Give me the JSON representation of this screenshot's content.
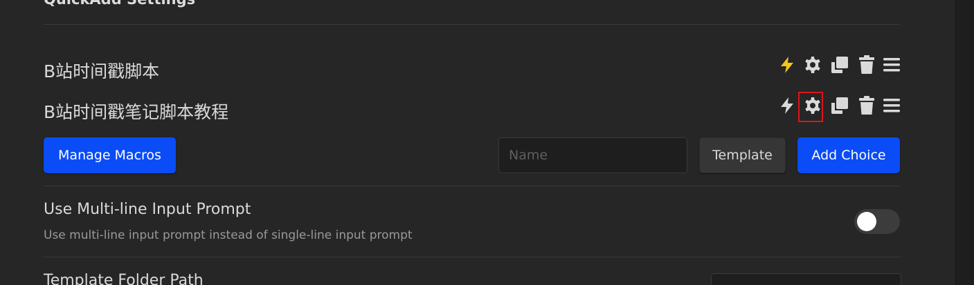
{
  "header": {
    "title": "QuickAdd Settings"
  },
  "choices": [
    {
      "name": "B站时间戳脚本",
      "command_active": true
    },
    {
      "name": "B站时间戳笔记脚本教程",
      "command_active": false
    }
  ],
  "icons": {
    "command": "lightning-icon",
    "settings": "gear-icon",
    "duplicate": "duplicate-icon",
    "delete": "trash-icon",
    "drag": "drag-handle-icon"
  },
  "colors": {
    "accent": "#0a4cf5",
    "command_active": "#f5c518",
    "icon": "#dadada",
    "highlight": "#e0151b"
  },
  "actions": {
    "manage_macros": "Manage Macros",
    "name_placeholder": "Name",
    "name_value": "",
    "type_button": "Template",
    "add_choice": "Add Choice"
  },
  "settings": [
    {
      "name": "Use Multi-line Input Prompt",
      "description": "Use multi-line input prompt instead of single-line input prompt",
      "enabled": false
    },
    {
      "name": "Template Folder Path",
      "description": ""
    }
  ]
}
